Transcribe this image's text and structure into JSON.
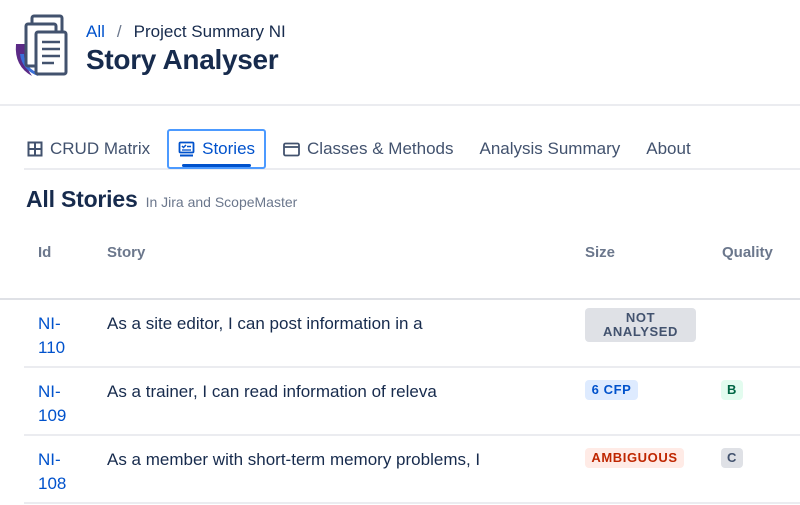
{
  "header": {
    "breadcrumb_root": "All",
    "breadcrumb_separator": "/",
    "breadcrumb_current": "Project Summary NI",
    "title": "Story Analyser",
    "logo_icon": "documents-stack-icon"
  },
  "tabs": [
    {
      "label": "CRUD Matrix",
      "icon": "grid-icon",
      "active": false
    },
    {
      "label": "Stories",
      "icon": "checklist-monitor-icon",
      "active": true
    },
    {
      "label": "Classes & Methods",
      "icon": "window-icon",
      "active": false
    },
    {
      "label": "Analysis Summary",
      "icon": "",
      "active": false
    },
    {
      "label": "About",
      "icon": "",
      "active": false
    }
  ],
  "section": {
    "title": "All Stories",
    "subtitle": "In Jira and ScopeMaster"
  },
  "table": {
    "columns": [
      "Id",
      "Story",
      "Size",
      "Quality"
    ],
    "rows": [
      {
        "id_line1": "NI-",
        "id_line2": "110",
        "story": "As a site editor, I can post information in a",
        "size": {
          "line1": "NOT",
          "line2": "ANALYSED",
          "style": "gray"
        },
        "quality": ""
      },
      {
        "id_line1": "NI-",
        "id_line2": "109",
        "story": "As a trainer, I can read information of releva",
        "size": {
          "line1": "6 CFP",
          "line2": "",
          "style": "blue"
        },
        "quality": "B"
      },
      {
        "id_line1": "NI-",
        "id_line2": "108",
        "story": "As a member with short-term memory problems, I",
        "size": {
          "line1": "AMBIGUOUS",
          "line2": "",
          "style": "red"
        },
        "quality": "C"
      }
    ]
  },
  "colors": {
    "link": "#0052cc",
    "text": "#172b4d",
    "muted": "#6b778c",
    "focus": "#4c9aff",
    "logo_accent": "#5b2a86"
  }
}
